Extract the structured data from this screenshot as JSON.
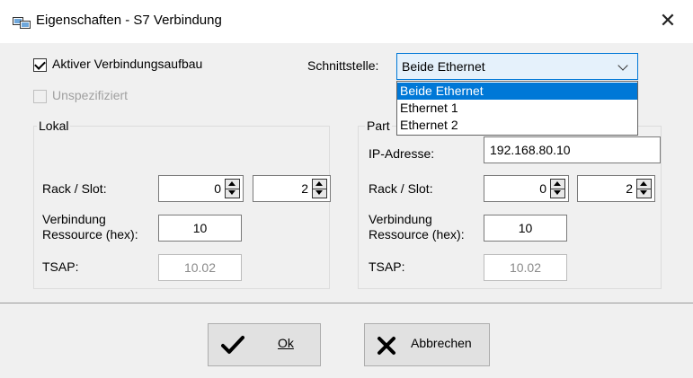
{
  "window": {
    "title": "Eigenschaften - S7 Verbindung",
    "close_glyph": "✕"
  },
  "options": {
    "aktiver_label": "Aktiver Verbindungsaufbau",
    "aktiver_checked": true,
    "unspezifiziert_label": "Unspezifiziert",
    "unspezifiziert_checked": false
  },
  "schnittstelle": {
    "label": "Schnittstelle:",
    "value": "Beide Ethernet",
    "options": [
      "Beide Ethernet",
      "Ethernet 1",
      "Ethernet 2"
    ],
    "selected_index": 0
  },
  "lokal": {
    "title": "Lokal",
    "rack_slot_label": "Rack / Slot:",
    "rack": "0",
    "slot": "2",
    "verbindung_label_1": "Verbindung",
    "verbindung_label_2": "Ressource (hex):",
    "ressource": "10",
    "tsap_label": "TSAP:",
    "tsap": "10.02"
  },
  "partner": {
    "title_visible": "Part",
    "ip_label": "IP-Adresse:",
    "ip": "192.168.80.10",
    "rack_slot_label": "Rack / Slot:",
    "rack": "0",
    "slot": "2",
    "verbindung_label_1": "Verbindung",
    "verbindung_label_2": "Ressource (hex):",
    "ressource": "10",
    "tsap_label": "TSAP:",
    "tsap": "10.02"
  },
  "buttons": {
    "ok": "Ok",
    "cancel": "Abbrechen"
  },
  "colors": {
    "accent": "#0078d7",
    "combo_bg": "#e5f1fb",
    "dialog_bg": "#f0f0f0"
  }
}
